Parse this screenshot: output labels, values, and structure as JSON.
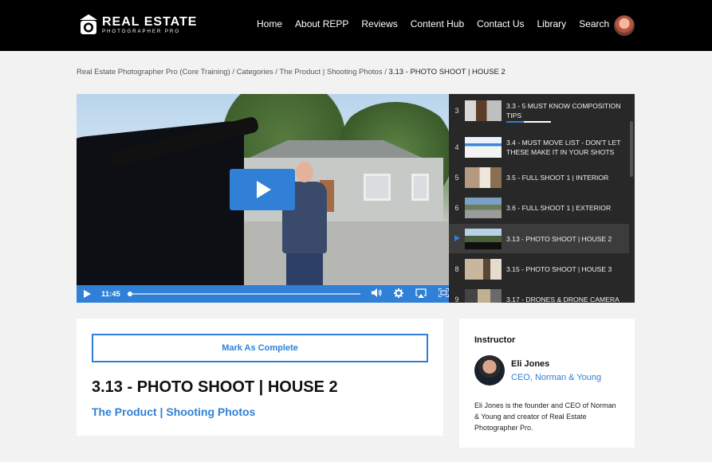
{
  "header": {
    "logo": {
      "main": "REAL ESTATE",
      "sub": "PHOTOGRAPHER PRO"
    },
    "nav": [
      "Home",
      "About REPP",
      "Reviews",
      "Content Hub",
      "Contact Us",
      "Library",
      "Search"
    ]
  },
  "breadcrumb": {
    "items": [
      "Real Estate Photographer Pro (Core Training)",
      "Categories",
      "The Product | Shooting Photos"
    ],
    "separator": " / ",
    "current": "3.13 - PHOTO SHOOT | HOUSE 2"
  },
  "video": {
    "time": "11:45",
    "progress": 0.0,
    "icons": [
      "play-icon",
      "volume-icon",
      "settings-icon",
      "airplay-icon",
      "fullscreen-icon"
    ]
  },
  "playlist": [
    {
      "num": "3",
      "title": "3.3 - 5 MUST KNOW COMPOSITION TIPS",
      "progress": 0.4
    },
    {
      "num": "4",
      "title": "3.4 - MUST MOVE LIST - DON'T LET THESE MAKE IT IN YOUR SHOTS"
    },
    {
      "num": "5",
      "title": "3.5 - FULL SHOOT 1 | INTERIOR"
    },
    {
      "num": "6",
      "title": "3.6 - FULL SHOOT 1 | EXTERIOR"
    },
    {
      "num": "",
      "title": "3.13 - PHOTO SHOOT | HOUSE 2",
      "active": true
    },
    {
      "num": "8",
      "title": "3.15 - PHOTO SHOOT | HOUSE 3"
    },
    {
      "num": "9",
      "title": "3.17 - DRONES & DRONE CAMERA"
    }
  ],
  "lesson": {
    "complete_label": "Mark As Complete",
    "title": "3.13 - PHOTO SHOOT | HOUSE 2",
    "category": "The Product | Shooting Photos"
  },
  "instructor": {
    "heading": "Instructor",
    "name": "Eli Jones",
    "role": "CEO, Norman & Young",
    "bio": "Eli Jones is the founder and CEO of Norman & Young and creator of Real Estate Photographer Pro."
  },
  "colors": {
    "accent": "#2f80d6",
    "header_bg": "#000000",
    "playlist_bg": "#282828"
  }
}
